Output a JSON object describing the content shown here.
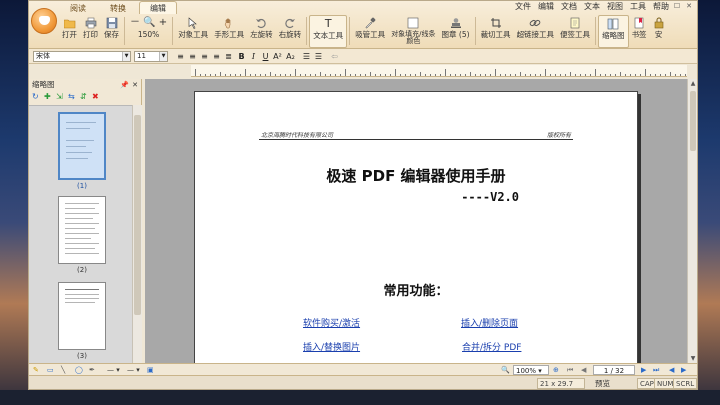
{
  "ribbon": {
    "tabs": [
      "阅读",
      "转换",
      "编辑"
    ],
    "active_tab": "编辑",
    "menu": [
      "文件",
      "编辑",
      "文档",
      "文本",
      "视图",
      "工具",
      "帮助"
    ],
    "tools": {
      "open": "打开",
      "print": "打印",
      "save": "保存",
      "zoom": "150%",
      "object_tool": "对象工具",
      "hand_tool": "手形工具",
      "rotate_left": "左旋转",
      "rotate_right": "右旋转",
      "text_tool": "文本工具",
      "suction_tool": "吸管工具",
      "object_fill_line1": "对象填充/线条",
      "object_fill_line2": "颜色",
      "layer": "图章 (5)",
      "crop_tool": "裁切工具",
      "link_tool": "超链接工具",
      "note_tool": "便签工具",
      "thumbnail": "缩略图",
      "bookmark": "书签",
      "security": "安"
    }
  },
  "format": {
    "font": "宋体",
    "size": "11"
  },
  "panel": {
    "title": "缩略图",
    "thumbnails": [
      {
        "label": "(1)",
        "selected": true
      },
      {
        "label": "(2)",
        "selected": false
      },
      {
        "label": "(3)",
        "selected": false
      }
    ]
  },
  "document": {
    "header_left": "北京海腾时代科技有限公司",
    "header_right": "版权所有",
    "title": "极速 PDF 编辑器使用手册",
    "version": "----V2.0",
    "subtitle": "常用功能：",
    "links": [
      {
        "text": "软件购买/激活"
      },
      {
        "text": "插入/删除页面"
      },
      {
        "text": "插入/替换图片"
      },
      {
        "text": "合并/拆分 PDF"
      }
    ]
  },
  "bottombar": {
    "zoom": "100%",
    "page_indicator": "1 / 32"
  },
  "statusbar": {
    "page_size": "21 x 29.7 cm",
    "mode": "预览",
    "cap": "CAP",
    "num": "NUM",
    "scrl": "SCRL"
  },
  "colors": {
    "ribbon_bg": "#f1e2c4",
    "link": "#1a3fae",
    "selected_thumb": "#4f86c6"
  }
}
